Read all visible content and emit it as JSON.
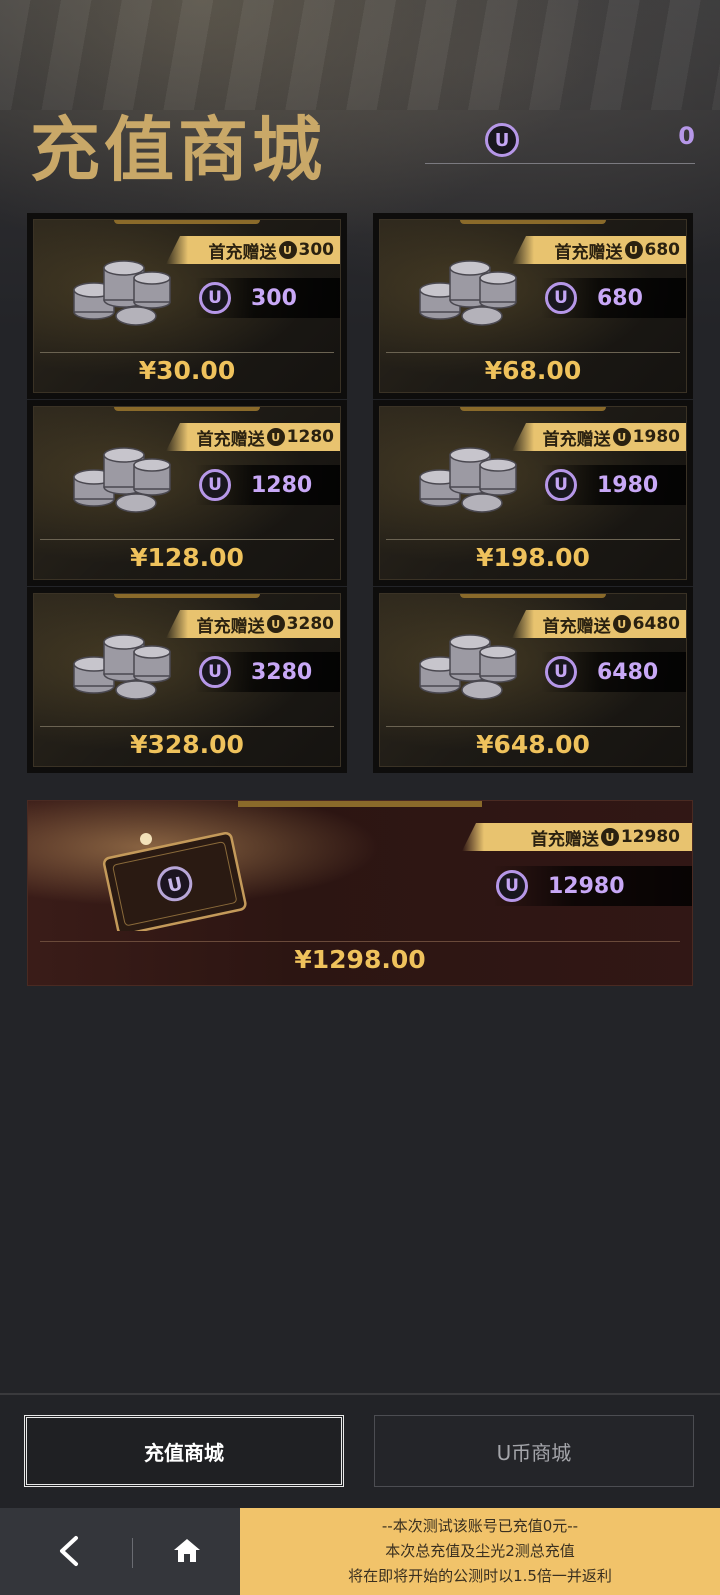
{
  "header": {
    "title": "充值商城",
    "balance": "0"
  },
  "packages": [
    {
      "bonus_prefix": "首充赠送",
      "bonus": "300",
      "amount": "300",
      "price": "¥30.00"
    },
    {
      "bonus_prefix": "首充赠送",
      "bonus": "680",
      "amount": "680",
      "price": "¥68.00"
    },
    {
      "bonus_prefix": "首充赠送",
      "bonus": "1280",
      "amount": "1280",
      "price": "¥128.00"
    },
    {
      "bonus_prefix": "首充赠送",
      "bonus": "1980",
      "amount": "1980",
      "price": "¥198.00"
    },
    {
      "bonus_prefix": "首充赠送",
      "bonus": "3280",
      "amount": "3280",
      "price": "¥328.00"
    },
    {
      "bonus_prefix": "首充赠送",
      "bonus": "6480",
      "amount": "6480",
      "price": "¥648.00"
    },
    {
      "bonus_prefix": "首充赠送",
      "bonus": "12980",
      "amount": "12980",
      "price": "¥1298.00"
    }
  ],
  "coin_symbol": "U",
  "tabs": [
    {
      "label": "充值商城",
      "active": true
    },
    {
      "label": "U币商城",
      "active": false
    }
  ],
  "notice": {
    "line1": "--本次测试该账号已充值0元--",
    "line2": "本次总充值及尘光2测总充值",
    "line3": "将在即将开始的公测时以1.5倍一并返利"
  },
  "icons": {
    "back": "chevron-left-icon",
    "home": "home-icon",
    "coin": "u-coin-icon"
  },
  "colors": {
    "accent_gold": "#e8c36f",
    "price_gold": "#efc25c",
    "coin_purple": "#b697e8",
    "notice_bg": "#f1c36a"
  }
}
